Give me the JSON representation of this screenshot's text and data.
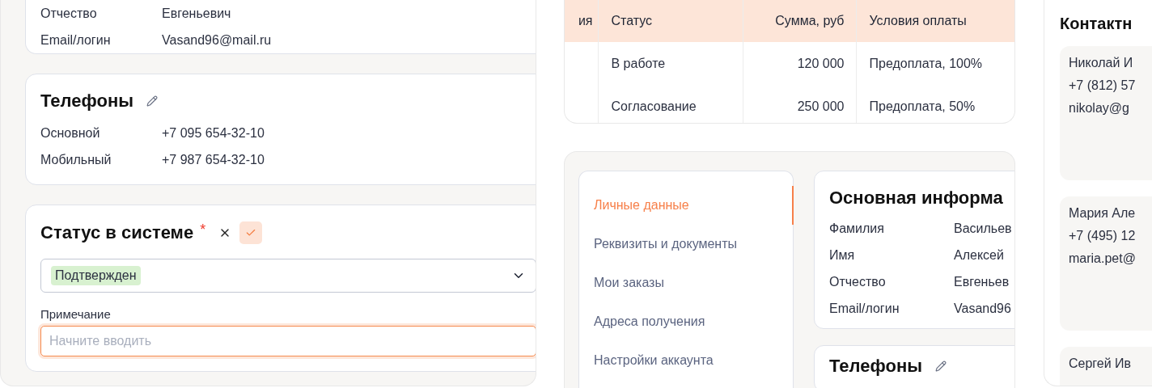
{
  "left_panel": {
    "personal_card": {
      "rows": [
        {
          "label": "Отчество",
          "value": "Евгеньевич"
        },
        {
          "label": "Email/логин",
          "value": "Vasand96@mail.ru"
        }
      ]
    },
    "phones_card": {
      "title": "Телефоны",
      "rows": [
        {
          "label": "Основной",
          "value": "+7 095 654-32-10"
        },
        {
          "label": "Мобильный",
          "value": "+7 987 654-32-10"
        }
      ]
    },
    "status_card": {
      "title": "Статус в системе",
      "required_mark": "*",
      "status_select": {
        "value": "Подтвержден"
      },
      "note": {
        "label": "Примечание",
        "placeholder": "Начните вводить",
        "focused": true
      }
    }
  },
  "orders_table": {
    "columns": [
      "ия",
      "Статус",
      "Сумма, руб",
      "Условия оплаты"
    ],
    "rows": [
      {
        "status": "В работе",
        "amount": "120 000",
        "terms": "Предоплата, 100%"
      },
      {
        "status": "Согласование",
        "amount": "250 000",
        "terms": "Предоплата, 50%"
      }
    ]
  },
  "profile": {
    "nav": [
      {
        "label": "Личные данные",
        "selected": true
      },
      {
        "label": "Реквизиты и документы",
        "selected": false
      },
      {
        "label": "Мои заказы",
        "selected": false
      },
      {
        "label": "Адреса получения",
        "selected": false
      },
      {
        "label": "Настройки аккаунта",
        "selected": false
      }
    ],
    "main_card": {
      "title": "Основная информа",
      "rows": [
        {
          "label": "Фамилия",
          "value": "Васильев"
        },
        {
          "label": "Имя",
          "value": "Алексей"
        },
        {
          "label": "Отчество",
          "value": "Евгеньев"
        },
        {
          "label": "Email/логин",
          "value": "Vasand96"
        }
      ]
    },
    "phones_card": {
      "title": "Телефоны"
    }
  },
  "contacts": {
    "title": "Контактн",
    "items": [
      {
        "name": "Николай И",
        "phone": "+7 (812) 57",
        "email": "nikolay@g"
      },
      {
        "name": "Мария Але",
        "phone": "+7 (495) 12",
        "email": "maria.pet@"
      },
      {
        "name": "Сергей Ив"
      }
    ]
  }
}
